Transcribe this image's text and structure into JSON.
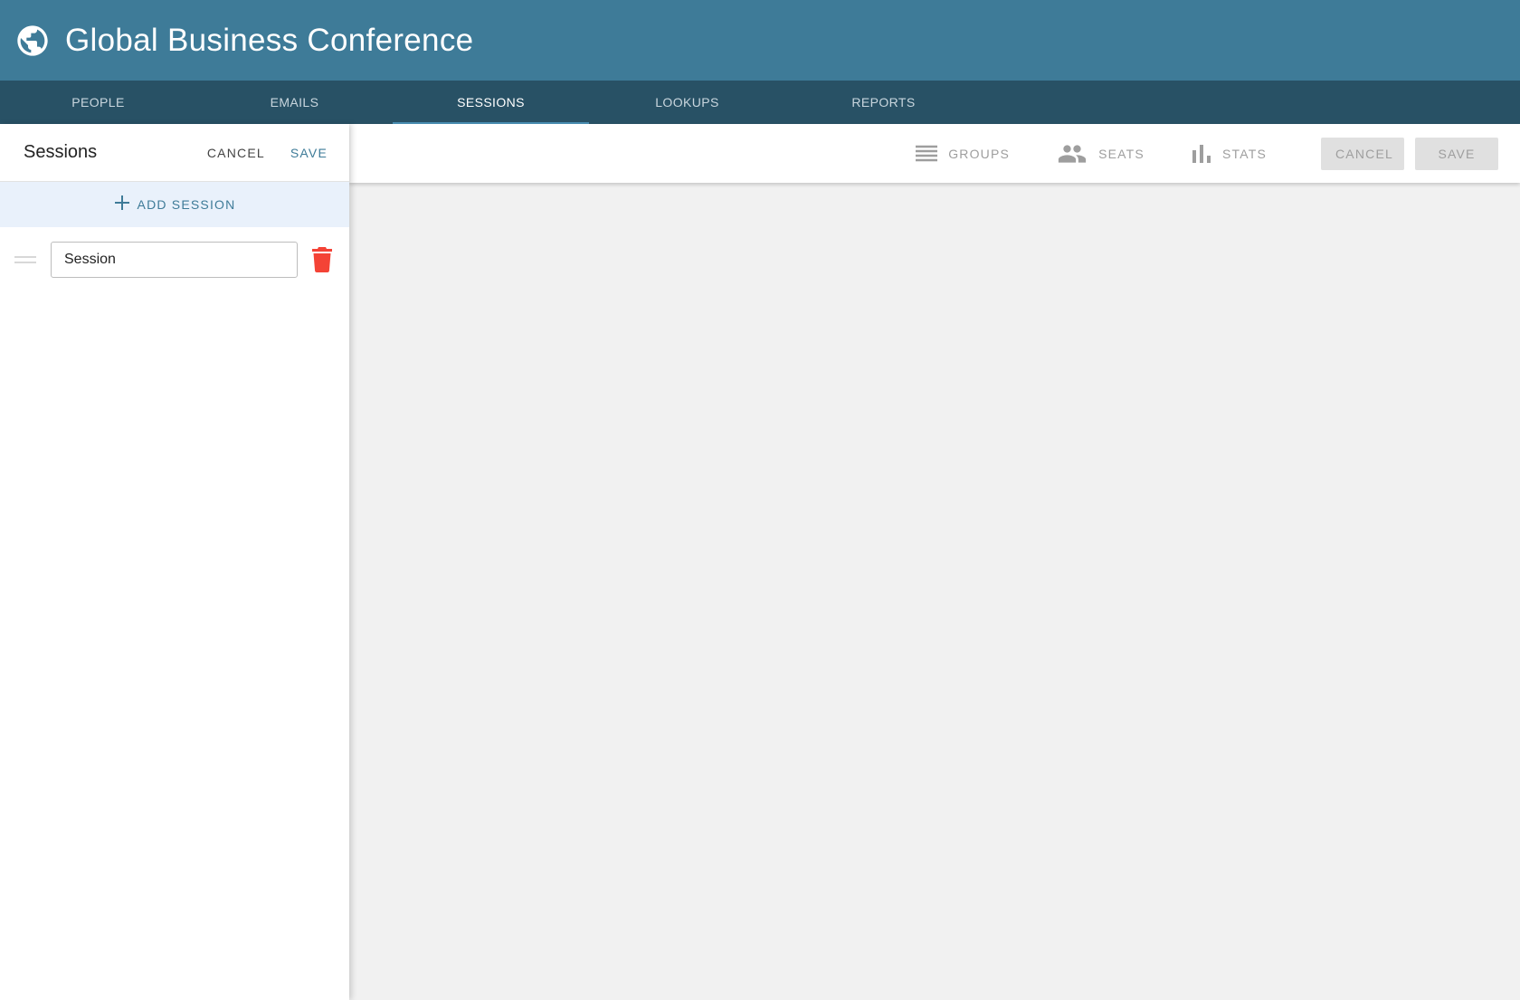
{
  "app": {
    "title": "Global Business Conference",
    "brand_color": "#3e7b98",
    "tabbar_color": "#285165"
  },
  "tabs": [
    {
      "label": "PEOPLE"
    },
    {
      "label": "EMAILS"
    },
    {
      "label": "SESSIONS",
      "active": true
    },
    {
      "label": "LOOKUPS"
    },
    {
      "label": "REPORTS"
    }
  ],
  "sessions_panel": {
    "title": "Sessions",
    "cancel_label": "CANCEL",
    "save_label": "SAVE",
    "add_label": "ADD SESSION",
    "items": [
      {
        "value": "Session"
      }
    ]
  },
  "toolbar": {
    "groups_label": "GROUPS",
    "seats_label": "SEATS",
    "stats_label": "STATS",
    "cancel_label": "CANCEL",
    "save_label": "SAVE"
  },
  "icons": {
    "logo": "globe-icon",
    "add": "plus-icon",
    "drag": "drag-handle-icon",
    "delete": "trash-icon",
    "groups": "list-icon",
    "seats": "people-icon",
    "stats": "bar-chart-icon"
  },
  "colors": {
    "delete": "#f44336",
    "add_row_bg": "#e9f1fb",
    "disabled_btn": "#e0e0e0"
  }
}
